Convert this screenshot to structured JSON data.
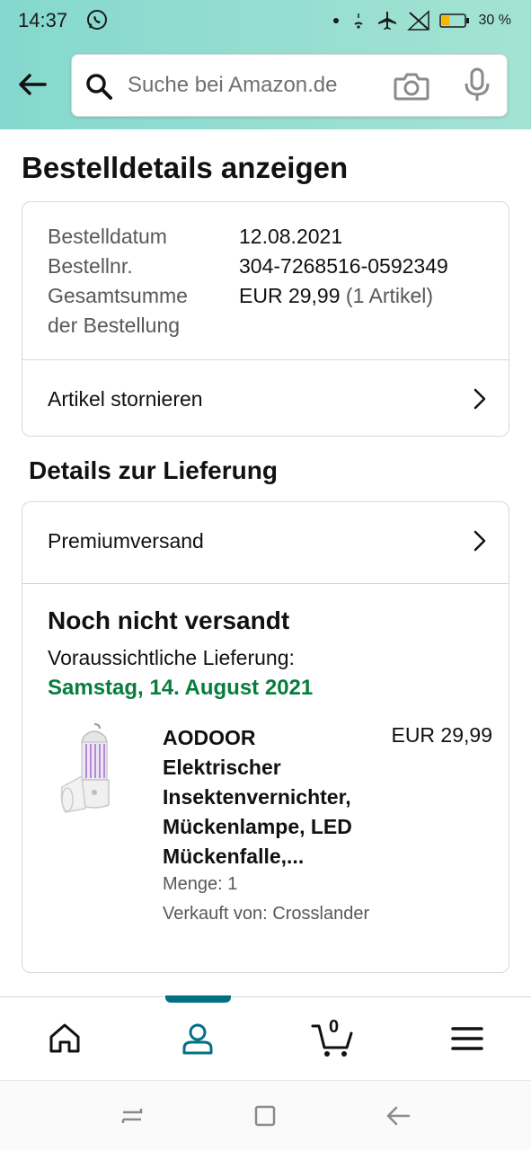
{
  "status_bar": {
    "time": "14:37",
    "battery_text": "30 %",
    "icons": [
      "whatsapp-icon",
      "dot-icon",
      "wifi-icon",
      "airplane-icon",
      "no-signal-icon",
      "battery-icon"
    ]
  },
  "header": {
    "search_placeholder": "Suche bei Amazon.de",
    "icons": [
      "back-arrow-icon",
      "search-icon",
      "camera-icon",
      "microphone-icon"
    ]
  },
  "page": {
    "title": "Bestelldetails anzeigen"
  },
  "order_summary": {
    "date_label": "Bestelldatum",
    "date_value": "12.08.2021",
    "number_label": "Bestellnr.",
    "number_value": "304-7268516-0592349",
    "total_label_line1": "Gesamtsumme",
    "total_label_line2": "der Bestellung",
    "total_value": "EUR 29,99",
    "total_items": "(1 Artikel)",
    "cancel_label": "Artikel stornieren"
  },
  "delivery": {
    "section_title": "Details zur Lieferung",
    "shipping_method": "Premiumversand",
    "status": "Noch nicht versandt",
    "eta_label": "Voraussichtliche Lieferung:",
    "eta_date": "Samstag, 14. August 2021",
    "eta_color": "#067d3c"
  },
  "item": {
    "title": "AODOOR Elektrischer Insektenvernichter, Mückenlampe, LED Mückenfalle,...",
    "price": "EUR 29,99",
    "quantity": "Menge: 1",
    "seller": "Verkauft von: Crosslander"
  },
  "bottom_nav": {
    "cart_count": "0",
    "active_tab": "account",
    "accent_color": "#007185",
    "icons": [
      "home-icon",
      "account-icon",
      "cart-icon",
      "menu-icon"
    ]
  }
}
